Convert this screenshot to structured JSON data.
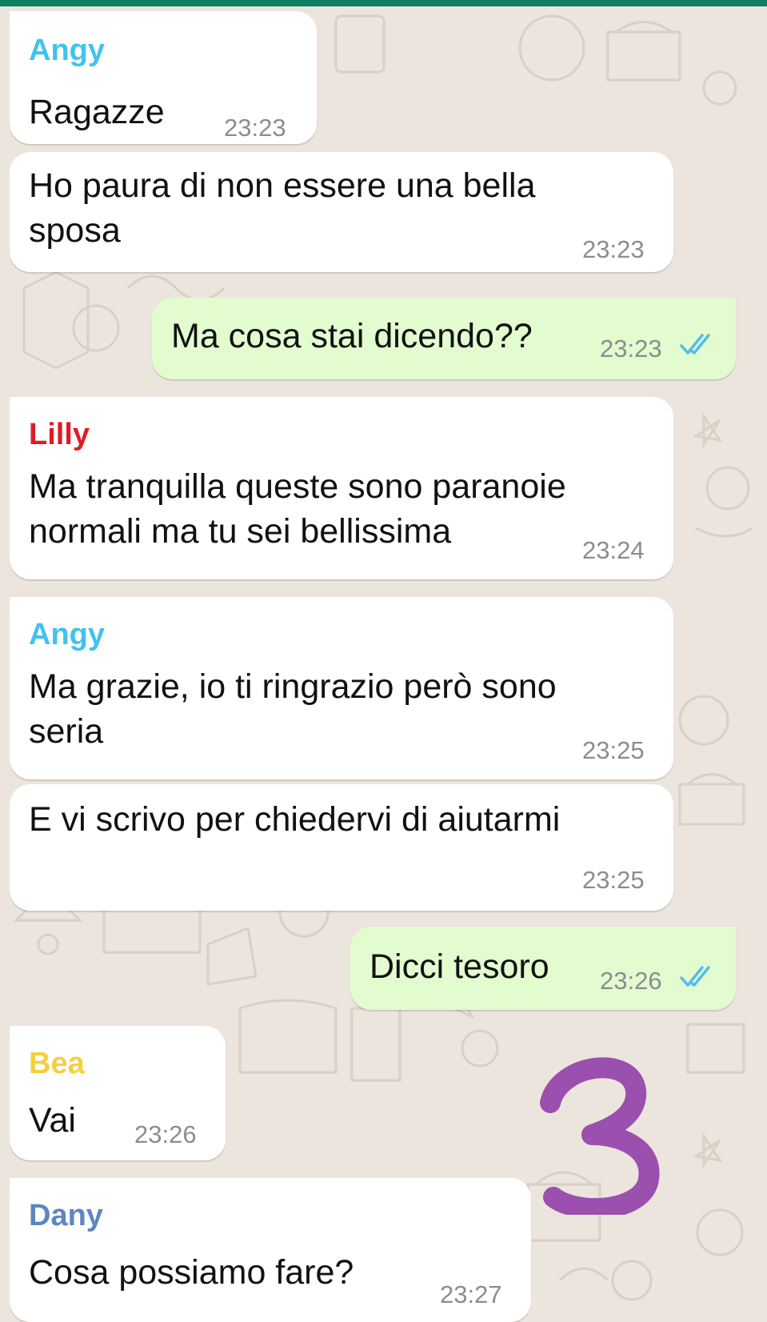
{
  "colors": {
    "background": "#ece5dd",
    "header_bar": "#0f7f62",
    "incoming_bubble": "#ffffff",
    "outgoing_bubble": "#e2fbcf",
    "read_ticks": "#53bdeb",
    "sticker": "#9b4fae"
  },
  "messages": [
    {
      "direction": "incoming",
      "sender": "Angy",
      "sender_color": "#3fc3ee",
      "text": "Ragazze",
      "time": "23:23"
    },
    {
      "direction": "incoming",
      "text": "Ho paura di non essere una bella sposa",
      "lines": [
        "Ho paura di non essere una bella",
        "sposa"
      ],
      "time": "23:23"
    },
    {
      "direction": "outgoing",
      "text": "Ma cosa stai dicendo??",
      "time": "23:23",
      "status_icon": "double-check-read-icon"
    },
    {
      "direction": "incoming",
      "sender": "Lilly",
      "sender_color": "#e01b24",
      "text": "Ma tranquilla queste sono paranoie normali ma tu sei bellissima",
      "lines": [
        "Ma tranquilla queste sono paranoie",
        "normali ma tu sei bellissima"
      ],
      "time": "23:24"
    },
    {
      "direction": "incoming",
      "sender": "Angy",
      "sender_color": "#3fc3ee",
      "text": "Ma grazie, io ti ringrazio però sono seria",
      "lines": [
        "Ma grazie, io ti ringrazio però sono",
        "seria"
      ],
      "time": "23:25"
    },
    {
      "direction": "incoming",
      "text": "E vi scrivo per chiedervi di aiutarmi",
      "time": "23:25"
    },
    {
      "direction": "outgoing",
      "text": "Dicci tesoro",
      "time": "23:26",
      "status_icon": "double-check-read-icon"
    },
    {
      "direction": "incoming",
      "sender": "Bea",
      "sender_color": "#f4d03f",
      "text": "Vai",
      "time": "23:26"
    },
    {
      "direction": "incoming",
      "sender": "Dany",
      "sender_color": "#5b86c5",
      "text": "Cosa possiamo fare?",
      "time": "23:27"
    }
  ],
  "sticker": {
    "icon": "handwritten-number-sticker",
    "text": "3"
  }
}
